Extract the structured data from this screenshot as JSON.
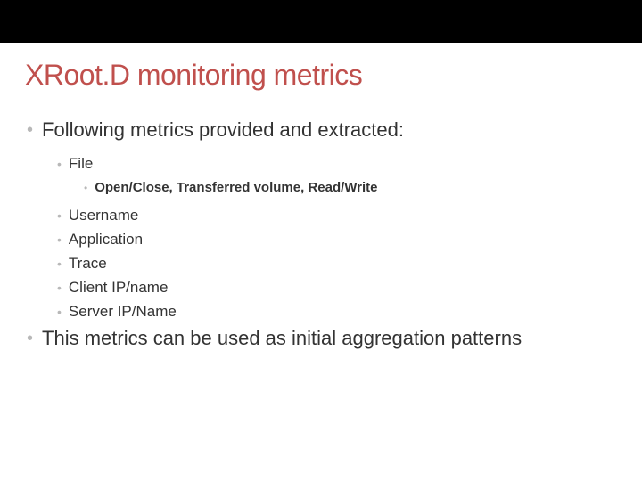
{
  "title": "XRoot.D monitoring metrics",
  "bullets": {
    "l1a": "Following metrics provided and extracted:",
    "l2_file": "File",
    "l3_file_detail": "Open/Close, Transferred volume, Read/Write",
    "l2_username": "Username",
    "l2_application": "Application",
    "l2_trace": "Trace",
    "l2_clientip": "Client IP/name",
    "l2_serverip": "Server IP/Name",
    "l1b": "This metrics can be used as initial aggregation patterns"
  }
}
